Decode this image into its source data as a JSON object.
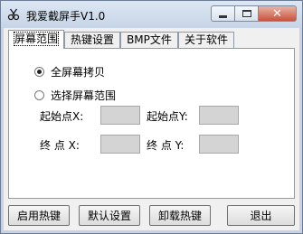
{
  "window": {
    "title": "我爱截屏手V1.0",
    "icons": {
      "app": "scissors-icon",
      "minimize": "minimize-icon",
      "maximize": "maximize-icon",
      "close": "close-icon"
    }
  },
  "tabs": [
    {
      "label": "屏幕范围",
      "active": true
    },
    {
      "label": "热键设置",
      "active": false
    },
    {
      "label": "BMP文件",
      "active": false
    },
    {
      "label": "关于软件",
      "active": false
    }
  ],
  "capture_mode": {
    "full_screen_label": "全屏幕拷贝",
    "select_area_label": "选择屏幕范围",
    "selected": "full_screen"
  },
  "coords": {
    "start_x_label": "起始点X:",
    "start_y_label": "起始点Y:",
    "end_x_label": "终 点 X:",
    "end_y_label": "终 点 Y:",
    "start_x_value": "",
    "start_y_value": "",
    "end_x_value": "",
    "end_y_value": ""
  },
  "buttons": {
    "enable_hotkey": "启用热键",
    "default_settings": "默认设置",
    "unload_hotkey": "卸载热键",
    "exit": "退出"
  }
}
